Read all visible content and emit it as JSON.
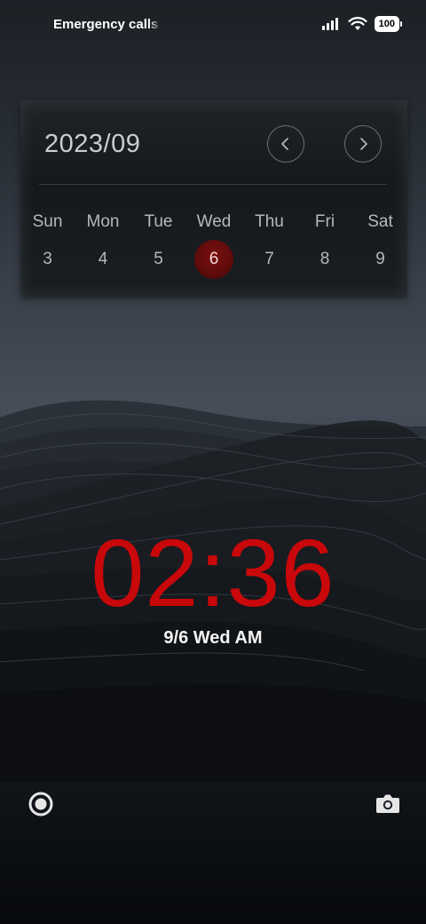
{
  "status_bar": {
    "carrier_text": "Emergency calls only",
    "battery": "100",
    "icons": [
      "signal-icon",
      "wifi-icon",
      "battery-icon"
    ]
  },
  "calendar": {
    "title": "2023/09",
    "weekdays": [
      "Sun",
      "Mon",
      "Tue",
      "Wed",
      "Thu",
      "Fri",
      "Sat"
    ],
    "days": [
      "3",
      "4",
      "5",
      "6",
      "7",
      "8",
      "9"
    ],
    "selected_day": "6",
    "prev_icon": "chevron-left-icon",
    "next_icon": "chevron-right-icon",
    "accent_color": "#6b0d0d"
  },
  "clock": {
    "time": "02:36",
    "date": "9/6 Wed AM",
    "color": "#c8080a"
  },
  "shortcuts": {
    "left_icon": "record-icon",
    "right_icon": "camera-icon"
  }
}
